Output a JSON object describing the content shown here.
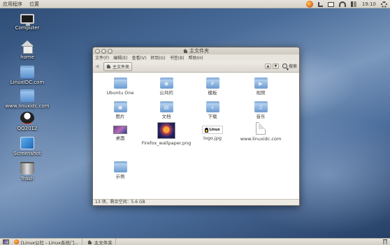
{
  "top_panel": {
    "menu_apps": "应用程序",
    "menu_places": "位置",
    "clock": "19:10"
  },
  "desktop": {
    "icons": [
      {
        "label": "Computer",
        "icon": "computer-icon"
      },
      {
        "label": "home",
        "icon": "home-folder-icon"
      },
      {
        "label": "LinuxIDC.com",
        "icon": "folder-icon"
      },
      {
        "label": "www.linuxidc.com",
        "icon": "folder-icon"
      },
      {
        "label": "QQ2012",
        "icon": "qq-icon"
      },
      {
        "label": "Screenshot",
        "icon": "screenshot-app-icon"
      },
      {
        "label": "Trash",
        "icon": "trash-icon"
      }
    ]
  },
  "window": {
    "title": "主文件夹",
    "menu": [
      "文件(F)",
      "编辑(E)",
      "查看(V)",
      "转到(G)",
      "书签(B)",
      "帮助(H)"
    ],
    "breadcrumb": "主文件夹",
    "search_label": "搜索",
    "files": [
      {
        "name": "Ubuntu One",
        "type": "folder"
      },
      {
        "name": "公共的",
        "type": "folder"
      },
      {
        "name": "模板",
        "type": "folder"
      },
      {
        "name": "视频",
        "type": "folder"
      },
      {
        "name": "图片",
        "type": "folder"
      },
      {
        "name": "文档",
        "type": "folder"
      },
      {
        "name": "下载",
        "type": "folder"
      },
      {
        "name": "音乐",
        "type": "folder"
      },
      {
        "name": "桌面",
        "type": "image"
      },
      {
        "name": "Firefox_wallpaper.png",
        "type": "image"
      },
      {
        "name": "logo.jpg",
        "type": "image"
      },
      {
        "name": "www.linuxidc.com",
        "type": "document"
      },
      {
        "name": "示例",
        "type": "folder"
      }
    ],
    "status": "13 项，剩余空间：5.6 GB"
  },
  "taskbar": {
    "tasks": [
      {
        "label": "[Linux公社 - Linux系统门..."
      },
      {
        "label": "主文件夹"
      }
    ]
  },
  "colors": {
    "panel": "#dfdbd2",
    "folder": "#6b9bd2",
    "text": "#3c3b37"
  }
}
